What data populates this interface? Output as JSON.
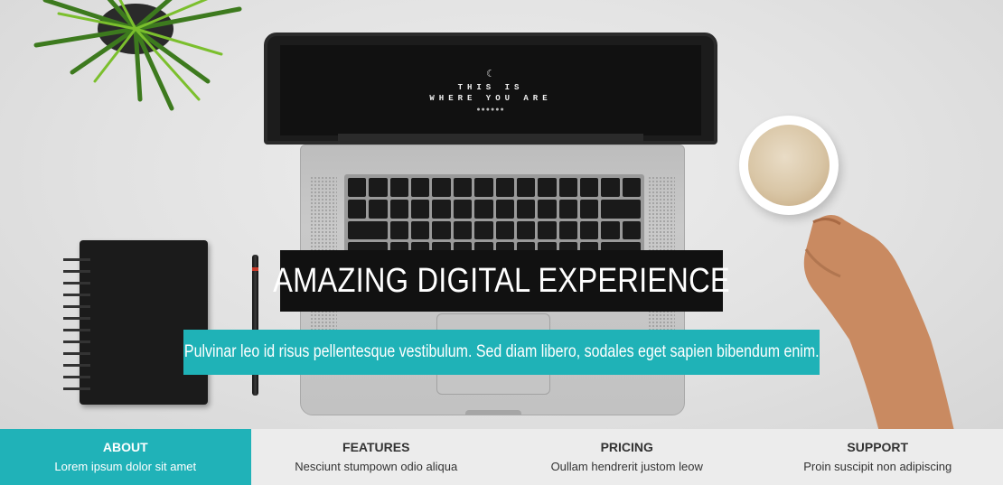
{
  "hero": {
    "laptop_screen": {
      "line1": "THIS IS",
      "line2": "WHERE YOU ARE"
    },
    "headline": "AMAZING DIGITAL EXPERIENCE",
    "subline": "Pulvinar leo id risus pellentesque vestibulum. Sed diam libero, sodales eget sapien bibendum enim."
  },
  "nav": {
    "items": [
      {
        "title": "ABOUT",
        "subtitle": "Lorem ipsum dolor sit amet",
        "active": true
      },
      {
        "title": "FEATURES",
        "subtitle": "Nesciunt stumpown odio aliqua",
        "active": false
      },
      {
        "title": "PRICING",
        "subtitle": "Oullam hendrerit justom leow",
        "active": false
      },
      {
        "title": "SUPPORT",
        "subtitle": "Proin suscipit non adipiscing",
        "active": false
      }
    ]
  },
  "colors": {
    "accent": "#20b2b8",
    "headline_bg": "#111111",
    "nav_bg": "#ececec",
    "text_dark": "#333333"
  },
  "icons": [
    "plant-image",
    "laptop-image",
    "notebook-image",
    "pen-image",
    "coffee-cup-image",
    "hand-image"
  ]
}
